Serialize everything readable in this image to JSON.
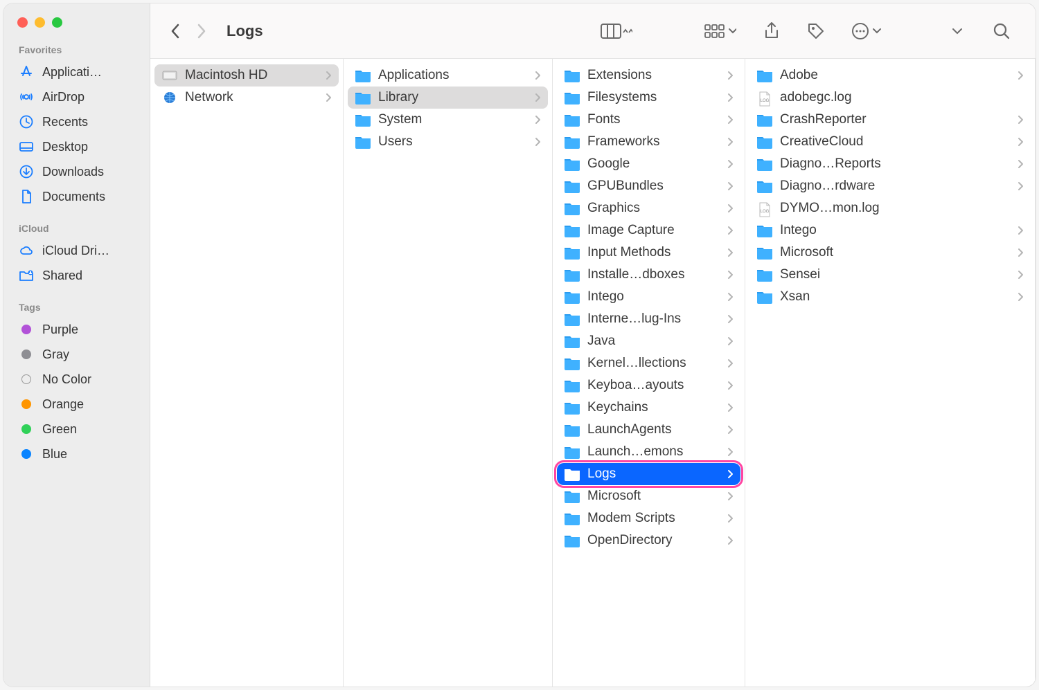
{
  "window_title": "Logs",
  "sidebar": {
    "sections": [
      {
        "header": "Favorites",
        "items": [
          {
            "icon": "app-store-icon",
            "label": "Applicati…"
          },
          {
            "icon": "airdrop-icon",
            "label": "AirDrop"
          },
          {
            "icon": "clock-icon",
            "label": "Recents"
          },
          {
            "icon": "desktop-icon",
            "label": "Desktop"
          },
          {
            "icon": "download-icon",
            "label": "Downloads"
          },
          {
            "icon": "document-icon",
            "label": "Documents"
          }
        ]
      },
      {
        "header": "iCloud",
        "items": [
          {
            "icon": "cloud-icon",
            "label": "iCloud Dri…"
          },
          {
            "icon": "shared-folder-icon",
            "label": "Shared"
          }
        ]
      },
      {
        "header": "Tags",
        "items": [
          {
            "icon": "tag-dot",
            "color": "#b252d8",
            "label": "Purple"
          },
          {
            "icon": "tag-dot",
            "color": "#8e8e93",
            "label": "Gray"
          },
          {
            "icon": "tag-dot-outline",
            "color": "",
            "label": "No Color"
          },
          {
            "icon": "tag-dot",
            "color": "#ff9500",
            "label": "Orange"
          },
          {
            "icon": "tag-dot",
            "color": "#30d158",
            "label": "Green"
          },
          {
            "icon": "tag-dot",
            "color": "#0a84ff",
            "label": "Blue"
          }
        ]
      }
    ]
  },
  "columns": [
    {
      "items": [
        {
          "kind": "hd",
          "label": "Macintosh HD",
          "chevron": true,
          "selected": "gray"
        },
        {
          "kind": "globe",
          "label": "Network",
          "chevron": true
        }
      ]
    },
    {
      "items": [
        {
          "kind": "folder",
          "label": "Applications",
          "chevron": true
        },
        {
          "kind": "folder",
          "label": "Library",
          "chevron": true,
          "selected": "gray"
        },
        {
          "kind": "folder",
          "label": "System",
          "chevron": true
        },
        {
          "kind": "folder",
          "label": "Users",
          "chevron": true
        }
      ]
    },
    {
      "items": [
        {
          "kind": "folder",
          "label": "Extensions",
          "chevron": true
        },
        {
          "kind": "folder",
          "label": "Filesystems",
          "chevron": true
        },
        {
          "kind": "folder",
          "label": "Fonts",
          "chevron": true
        },
        {
          "kind": "folder",
          "label": "Frameworks",
          "chevron": true
        },
        {
          "kind": "folder",
          "label": "Google",
          "chevron": true
        },
        {
          "kind": "folder",
          "label": "GPUBundles",
          "chevron": true
        },
        {
          "kind": "folder",
          "label": "Graphics",
          "chevron": true
        },
        {
          "kind": "folder",
          "label": "Image Capture",
          "chevron": true
        },
        {
          "kind": "folder",
          "label": "Input Methods",
          "chevron": true
        },
        {
          "kind": "folder",
          "label": "Installe…dboxes",
          "chevron": true
        },
        {
          "kind": "folder",
          "label": "Intego",
          "chevron": true
        },
        {
          "kind": "folder",
          "label": "Interne…lug-Ins",
          "chevron": true
        },
        {
          "kind": "folder",
          "label": "Java",
          "chevron": true
        },
        {
          "kind": "folder",
          "label": "Kernel…llections",
          "chevron": true
        },
        {
          "kind": "folder",
          "label": "Keyboa…ayouts",
          "chevron": true
        },
        {
          "kind": "folder",
          "label": "Keychains",
          "chevron": true
        },
        {
          "kind": "folder",
          "label": "LaunchAgents",
          "chevron": true
        },
        {
          "kind": "folder",
          "label": "Launch…emons",
          "chevron": true
        },
        {
          "kind": "folder",
          "label": "Logs",
          "chevron": true,
          "selected": "blue",
          "highlight": true
        },
        {
          "kind": "folder",
          "label": "Microsoft",
          "chevron": true
        },
        {
          "kind": "folder",
          "label": "Modem Scripts",
          "chevron": true
        },
        {
          "kind": "folder",
          "label": "OpenDirectory",
          "chevron": true
        }
      ]
    },
    {
      "items": [
        {
          "kind": "folder",
          "label": "Adobe",
          "chevron": true
        },
        {
          "kind": "logfile",
          "label": "adobegc.log",
          "chevron": false
        },
        {
          "kind": "folder",
          "label": "CrashReporter",
          "chevron": true
        },
        {
          "kind": "folder",
          "label": "CreativeCloud",
          "chevron": true
        },
        {
          "kind": "folder",
          "label": "Diagno…Reports",
          "chevron": true
        },
        {
          "kind": "folder",
          "label": "Diagno…rdware",
          "chevron": true
        },
        {
          "kind": "logfile",
          "label": "DYMO…mon.log",
          "chevron": false
        },
        {
          "kind": "folder",
          "label": "Intego",
          "chevron": true
        },
        {
          "kind": "folder",
          "label": "Microsoft",
          "chevron": true
        },
        {
          "kind": "folder",
          "label": "Sensei",
          "chevron": true
        },
        {
          "kind": "folder",
          "label": "Xsan",
          "chevron": true
        }
      ]
    }
  ]
}
